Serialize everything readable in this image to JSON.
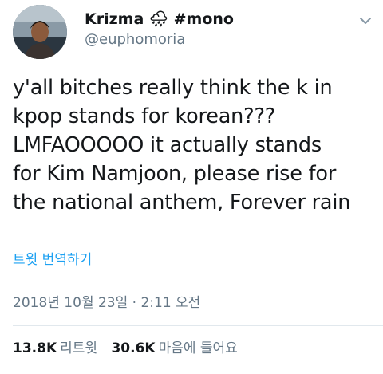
{
  "user": {
    "display_name": "Krizma 🌧 #mono",
    "handle": "@euphomoria"
  },
  "tweet": {
    "text": "y'all bitches really think the k in\nkpop stands for korean???\nLMFAOOOOO it actually stands\nfor Kim Namjoon, please rise for\nthe national anthem, Forever rain",
    "translate_label": "트윗 번역하기",
    "timestamp": "2018년 10월 23일 · 2:11 오전"
  },
  "stats": {
    "retweets_count": "13.8K",
    "retweets_label": "리트윗",
    "likes_count": "30.6K",
    "likes_label": "마음에 들어요"
  },
  "icons": {
    "more": "chevron-down-icon",
    "avatar": "avatar"
  },
  "colors": {
    "link": "#1da1f2",
    "secondary_text": "#657786",
    "primary_text": "#14171a"
  }
}
